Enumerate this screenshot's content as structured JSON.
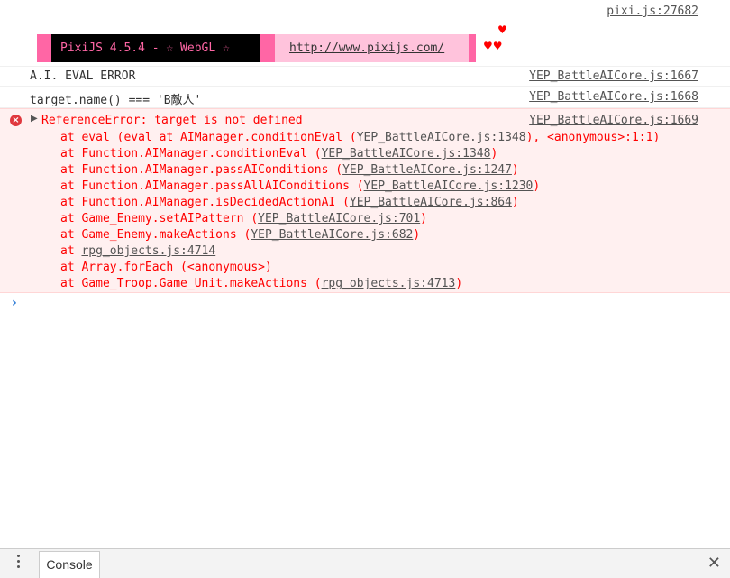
{
  "top": {
    "source": "pixi.js:27682"
  },
  "banner": {
    "text": "PixiJS 4.5.4 - ☆ WebGL ☆",
    "url": "http://www.pixijs.com/",
    "hearts": [
      "♥",
      "♥♥"
    ]
  },
  "messages": [
    {
      "text": "A.I. EVAL ERROR",
      "source": "YEP_BattleAICore.js:1667"
    },
    {
      "text": "target.name() === 'B敵人'",
      "source": "YEP_BattleAICore.js:1668"
    }
  ],
  "error": {
    "icon": "×",
    "arrow": "▶",
    "title": "ReferenceError: target is not defined",
    "source": "YEP_BattleAICore.js:1669",
    "stack": [
      {
        "pre": "at eval (eval at AIManager.conditionEval (",
        "link": "YEP_BattleAICore.js:1348",
        "post": "), <anonymous>:1:1)"
      },
      {
        "pre": "at Function.AIManager.conditionEval (",
        "link": "YEP_BattleAICore.js:1348",
        "post": ")"
      },
      {
        "pre": "at Function.AIManager.passAIConditions (",
        "link": "YEP_BattleAICore.js:1247",
        "post": ")"
      },
      {
        "pre": "at Function.AIManager.passAllAIConditions (",
        "link": "YEP_BattleAICore.js:1230",
        "post": ")"
      },
      {
        "pre": "at Function.AIManager.isDecidedActionAI (",
        "link": "YEP_BattleAICore.js:864",
        "post": ")"
      },
      {
        "pre": "at Game_Enemy.setAIPattern (",
        "link": "YEP_BattleAICore.js:701",
        "post": ")"
      },
      {
        "pre": "at Game_Enemy.makeActions (",
        "link": "YEP_BattleAICore.js:682",
        "post": ")"
      },
      {
        "pre": "at ",
        "link": "rpg_objects.js:4714",
        "post": ""
      },
      {
        "pre": "at Array.forEach (<anonymous>)",
        "link": "",
        "post": ""
      },
      {
        "pre": "at Game_Troop.Game_Unit.makeActions (",
        "link": "rpg_objects.js:4713",
        "post": ")"
      }
    ]
  },
  "prompt": "›",
  "drawer": {
    "tab_label": "Console",
    "close": "✕"
  }
}
